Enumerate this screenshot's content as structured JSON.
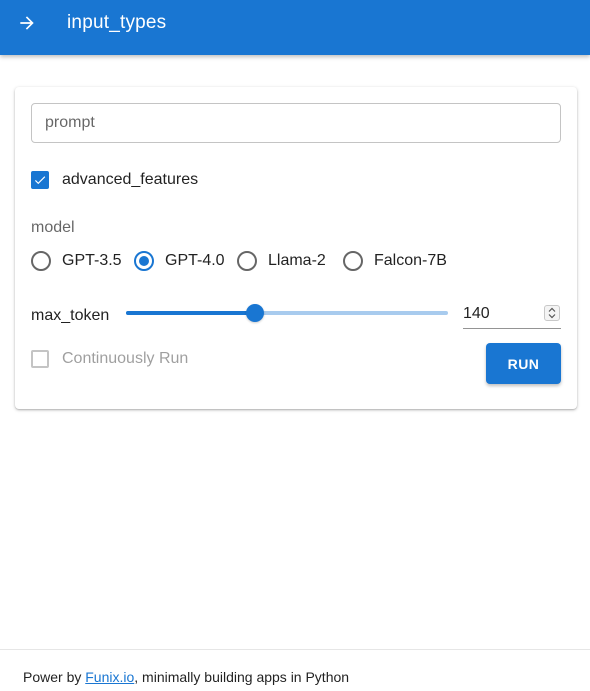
{
  "appbar": {
    "title": "input_types",
    "color": "#1976d2",
    "nav_icon": "arrow-right-icon"
  },
  "form": {
    "prompt": {
      "placeholder": "prompt",
      "value": ""
    },
    "advanced_features": {
      "label": "advanced_features",
      "checked": true
    },
    "model": {
      "label": "model",
      "options": [
        "GPT-3.5",
        "GPT-4.0",
        "Llama-2",
        "Falcon-7B"
      ],
      "selected": "GPT-4.0"
    },
    "max_token": {
      "label": "max_token",
      "value": "140",
      "slider_fraction": 0.4
    },
    "continuously_run": {
      "label": "Continuously Run",
      "checked": false
    },
    "run_label": "RUN"
  },
  "footer": {
    "prefix": "Power by ",
    "link": "Funix.io",
    "suffix": ", minimally building apps in Python"
  }
}
